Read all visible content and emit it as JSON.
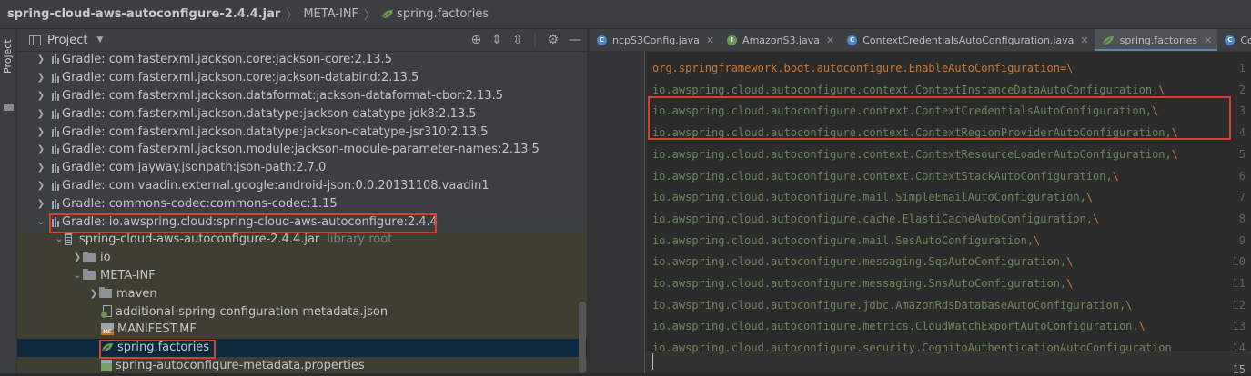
{
  "breadcrumb": {
    "jar": "spring-cloud-aws-autoconfigure-2.4.4.jar",
    "folder": "META-INF",
    "file": "spring.factories"
  },
  "side_strip": {
    "label": "Project"
  },
  "project_panel": {
    "title": "Project",
    "rows": [
      {
        "text": "Gradle: com.fasterxml.jackson.core:jackson-core:2.13.5"
      },
      {
        "text": "Gradle: com.fasterxml.jackson.core:jackson-databind:2.13.5"
      },
      {
        "text": "Gradle: com.fasterxml.jackson.dataformat:jackson-dataformat-cbor:2.13.5"
      },
      {
        "text": "Gradle: com.fasterxml.jackson.datatype:jackson-datatype-jdk8:2.13.5"
      },
      {
        "text": "Gradle: com.fasterxml.jackson.datatype:jackson-datatype-jsr310:2.13.5"
      },
      {
        "text": "Gradle: com.fasterxml.jackson.module:jackson-module-parameter-names:2.13.5"
      },
      {
        "text": "Gradle: com.jayway.jsonpath:json-path:2.7.0"
      },
      {
        "text": "Gradle: com.vaadin.external.google:android-json:0.0.20131108.vaadin1"
      },
      {
        "text": "Gradle: commons-codec:commons-codec:1.15"
      },
      {
        "text": "Gradle: io.awspring.cloud:spring-cloud-aws-autoconfigure:2.4.4"
      },
      {
        "text": "spring-cloud-aws-autoconfigure-2.4.4.jar",
        "note": "library root"
      },
      {
        "text": "io"
      },
      {
        "text": "META-INF"
      },
      {
        "text": "maven"
      },
      {
        "text": "additional-spring-configuration-metadata.json"
      },
      {
        "text": "MANIFEST.MF"
      },
      {
        "text": "spring.factories"
      },
      {
        "text": "spring-autoconfigure-metadata.properties"
      }
    ]
  },
  "tabs": [
    {
      "label": "ncpS3Config.java",
      "icon_letter": "C",
      "color": "#4a88c7"
    },
    {
      "label": "AmazonS3.java",
      "icon_letter": "I",
      "color": "#6a9955"
    },
    {
      "label": "ContextCredentialsAutoConfiguration.java",
      "icon_letter": "C",
      "color": "#4a88c7"
    },
    {
      "label": "spring.factories",
      "icon_letter": "",
      "color": "#6a9955"
    },
    {
      "label": "Context",
      "icon_letter": "C",
      "color": "#4a88c7"
    }
  ],
  "code": {
    "lines": [
      {
        "num": "1",
        "text": "org.springframework.boot.autoconfigure.EnableAutoConfiguration=\\"
      },
      {
        "num": "2",
        "text": "io.awspring.cloud.autoconfigure.context.ContextInstanceDataAutoConfiguration,\\"
      },
      {
        "num": "3",
        "text": "io.awspring.cloud.autoconfigure.context.ContextCredentialsAutoConfiguration,\\"
      },
      {
        "num": "4",
        "text": "io.awspring.cloud.autoconfigure.context.ContextRegionProviderAutoConfiguration,\\"
      },
      {
        "num": "5",
        "text": "io.awspring.cloud.autoconfigure.context.ContextResourceLoaderAutoConfiguration,\\"
      },
      {
        "num": "6",
        "text": "io.awspring.cloud.autoconfigure.context.ContextStackAutoConfiguration,\\"
      },
      {
        "num": "7",
        "text": "io.awspring.cloud.autoconfigure.mail.SimpleEmailAutoConfiguration,\\"
      },
      {
        "num": "8",
        "text": "io.awspring.cloud.autoconfigure.cache.ElastiCacheAutoConfiguration,\\"
      },
      {
        "num": "9",
        "text": "io.awspring.cloud.autoconfigure.mail.SesAutoConfiguration,\\"
      },
      {
        "num": "10",
        "text": "io.awspring.cloud.autoconfigure.messaging.SqsAutoConfiguration,\\"
      },
      {
        "num": "11",
        "text": "io.awspring.cloud.autoconfigure.messaging.SnsAutoConfiguration,\\"
      },
      {
        "num": "12",
        "text": "io.awspring.cloud.autoconfigure.jdbc.AmazonRdsDatabaseAutoConfiguration,\\"
      },
      {
        "num": "13",
        "text": "io.awspring.cloud.autoconfigure.metrics.CloudWatchExportAutoConfiguration,\\"
      },
      {
        "num": "14",
        "text": "io.awspring.cloud.autoconfigure.security.CognitoAuthenticationAutoConfiguration"
      },
      {
        "num": "15",
        "text": ""
      }
    ]
  },
  "colors": {
    "highlight_box": "#d5412c",
    "selection": "#0d293e",
    "key": "#cc7832",
    "value": "#6a8759"
  }
}
